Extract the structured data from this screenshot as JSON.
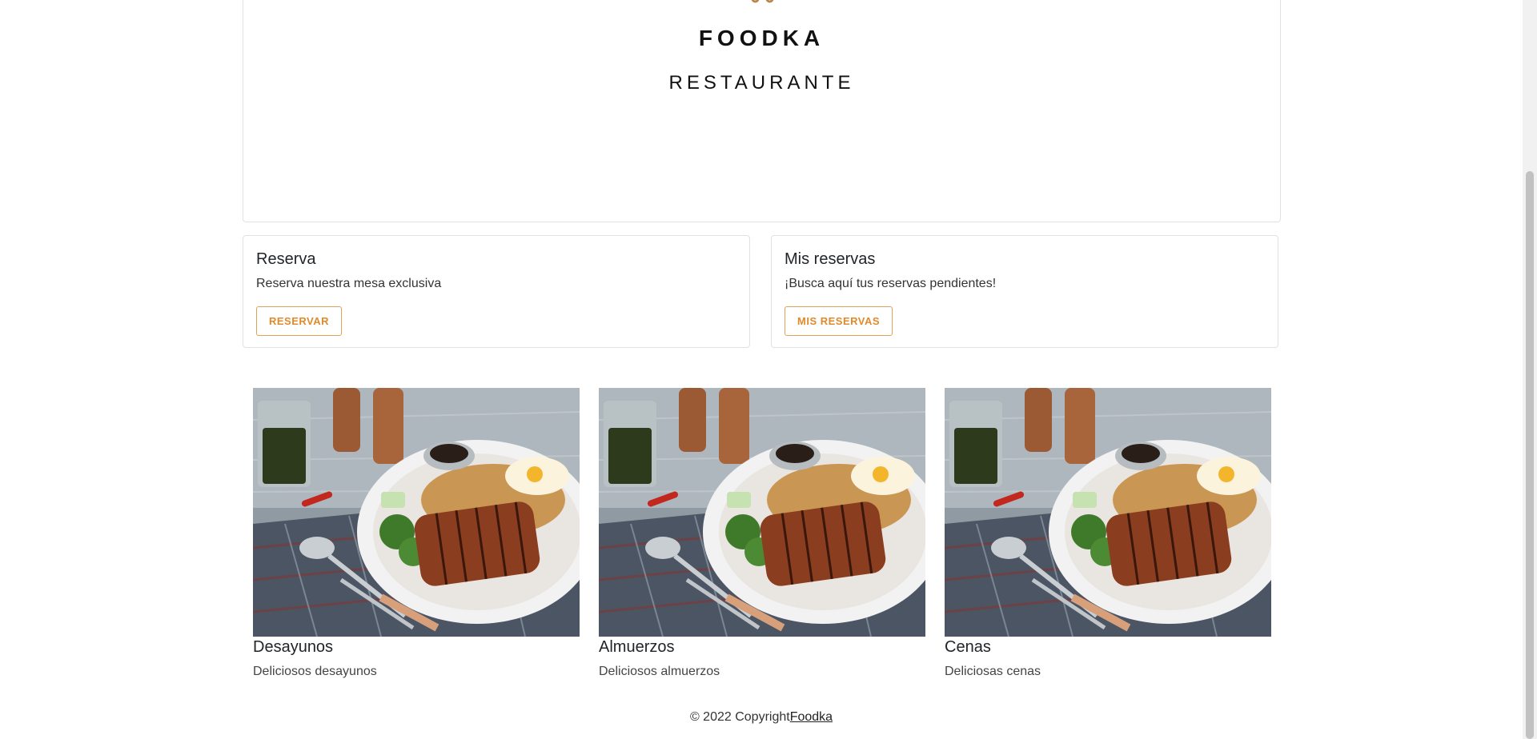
{
  "hero": {
    "brand": "FOODKA",
    "tagline": "RESTAURANTE",
    "accent_color": "#b8864b"
  },
  "cards": [
    {
      "title": "Reserva",
      "text": "Reserva nuestra mesa exclusiva",
      "button_label": "RESERVAR"
    },
    {
      "title": "Mis reservas",
      "text": "¡Busca aquí tus reservas pendientes!",
      "button_label": "MIS RESERVAS"
    }
  ],
  "menu": [
    {
      "title": "Desayunos",
      "description": "Deliciosos desayunos",
      "image": "grilled-pork-plate-photo"
    },
    {
      "title": "Almuerzos",
      "description": "Deliciosos almuerzos",
      "image": "grilled-pork-plate-photo"
    },
    {
      "title": "Cenas",
      "description": "Deliciosas cenas",
      "image": "grilled-pork-plate-photo"
    }
  ],
  "footer": {
    "copyright": "© 2022 Copyright",
    "link": "Foodka"
  },
  "colors": {
    "button_accent": "#e08a2b",
    "border": "#dee2e6"
  }
}
